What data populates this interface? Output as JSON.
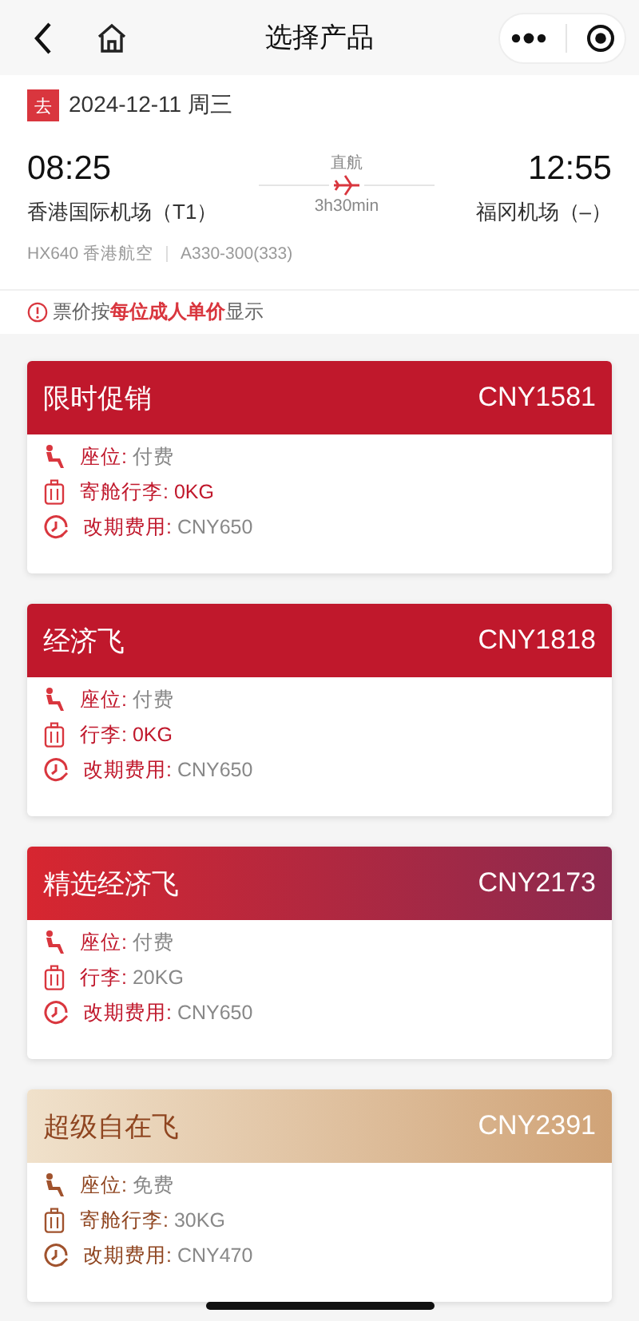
{
  "nav": {
    "title": "选择产品"
  },
  "trip": {
    "direction": "去",
    "date": "2024-12-11 周三"
  },
  "flight": {
    "depart_time": "08:25",
    "depart_airport": "香港国际机场（T1）",
    "type": "直航",
    "duration": "3h30min",
    "arrive_time": "12:55",
    "arrive_airport": "福冈机场（–）",
    "flight_no": "HX640 香港航空",
    "aircraft": "A330-300(333)"
  },
  "notice": "票价按**每位成人单价**显示",
  "products": [
    {
      "name": "限时促销",
      "price": "CNY1581",
      "kind": "red",
      "features": [
        {
          "kind": "seat",
          "label": "座位:",
          "value": "付费",
          "highlighted": false
        },
        {
          "kind": "baggage",
          "label": "寄舱行李:",
          "value": "0KG",
          "highlighted": true
        },
        {
          "kind": "change",
          "label": "改期费用:",
          "value": "CNY650",
          "highlighted": false
        }
      ]
    },
    {
      "name": "经济飞",
      "price": "CNY1818",
      "kind": "red",
      "features": [
        {
          "kind": "seat",
          "label": "座位:",
          "value": "付费",
          "highlighted": false
        },
        {
          "kind": "baggage",
          "label": "行李:",
          "value": "0KG",
          "highlighted": true
        },
        {
          "kind": "change",
          "label": "改期费用:",
          "value": "CNY650",
          "highlighted": false
        }
      ]
    },
    {
      "name": "精选经济飞",
      "price": "CNY2173",
      "kind": "plum",
      "features": [
        {
          "kind": "seat",
          "label": "座位:",
          "value": "付费",
          "highlighted": false
        },
        {
          "kind": "baggage",
          "label": "行李:",
          "value": "20KG",
          "highlighted": false
        },
        {
          "kind": "change",
          "label": "改期费用:",
          "value": "CNY650",
          "highlighted": false
        }
      ]
    },
    {
      "name": "超级自在飞",
      "price": "CNY2391",
      "kind": "gold",
      "features": [
        {
          "kind": "seat",
          "label": "座位:",
          "value": "免费",
          "highlighted": false
        },
        {
          "kind": "baggage",
          "label": "寄舱行李:",
          "value": "30KG",
          "highlighted": false
        },
        {
          "kind": "change",
          "label": "改期费用:",
          "value": "CNY470",
          "highlighted": false
        }
      ]
    }
  ]
}
